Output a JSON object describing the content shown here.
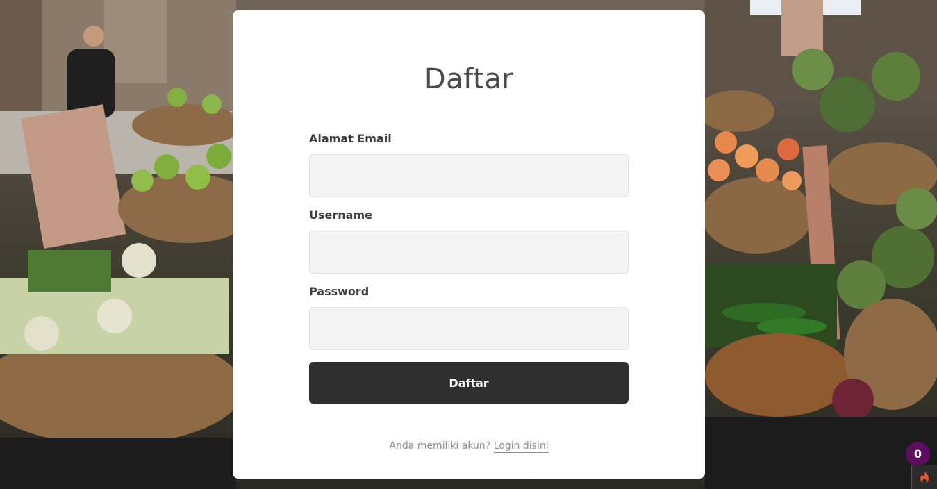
{
  "page": {
    "title": "Daftar"
  },
  "form": {
    "email_label": "Alamat Email",
    "email_value": "",
    "username_label": "Username",
    "username_value": "",
    "password_label": "Password",
    "password_value": "",
    "submit_label": "Daftar"
  },
  "footer": {
    "prompt_text": "Anda memiliki akun?",
    "login_link_text": "Login disini"
  },
  "notification": {
    "count": "0"
  },
  "icons": {
    "flame": "flame-icon"
  },
  "colors": {
    "card_background": "#ffffff",
    "button_background": "#2f2f2f",
    "field_background": "#f3f3f3",
    "badge_background": "#5b0d5e",
    "flame": "#e8542a"
  }
}
